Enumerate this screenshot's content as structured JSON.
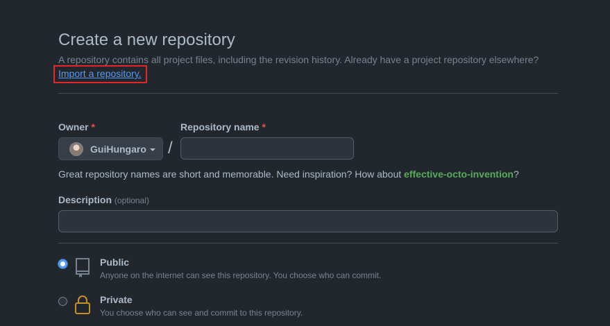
{
  "header": {
    "title": "Create a new repository",
    "subtitle": "A repository contains all project files, including the revision history. Already have a project repository elsewhere?",
    "import_link": "Import a repository."
  },
  "owner": {
    "label": "Owner",
    "required_mark": "*",
    "selected": "GuiHungaro"
  },
  "repo_name": {
    "label": "Repository name",
    "required_mark": "*",
    "value": "",
    "separator": "/"
  },
  "hint": {
    "text": "Great repository names are short and memorable. Need inspiration? How about ",
    "suggestion": "effective-octo-invention",
    "suffix": "?"
  },
  "description": {
    "label": "Description",
    "optional": "(optional)",
    "value": ""
  },
  "visibility": {
    "options": [
      {
        "title": "Public",
        "desc": "Anyone on the internet can see this repository. You choose who can commit.",
        "icon": "repo-icon",
        "checked": true
      },
      {
        "title": "Private",
        "desc": "You choose who can see and commit to this repository.",
        "icon": "lock-icon",
        "checked": false
      }
    ]
  },
  "colors": {
    "background": "#22272e",
    "link": "#539bf5",
    "suggestion": "#57ab5a",
    "required": "#e5534b",
    "lock": "#c69026",
    "highlight_box": "#e5252a"
  }
}
